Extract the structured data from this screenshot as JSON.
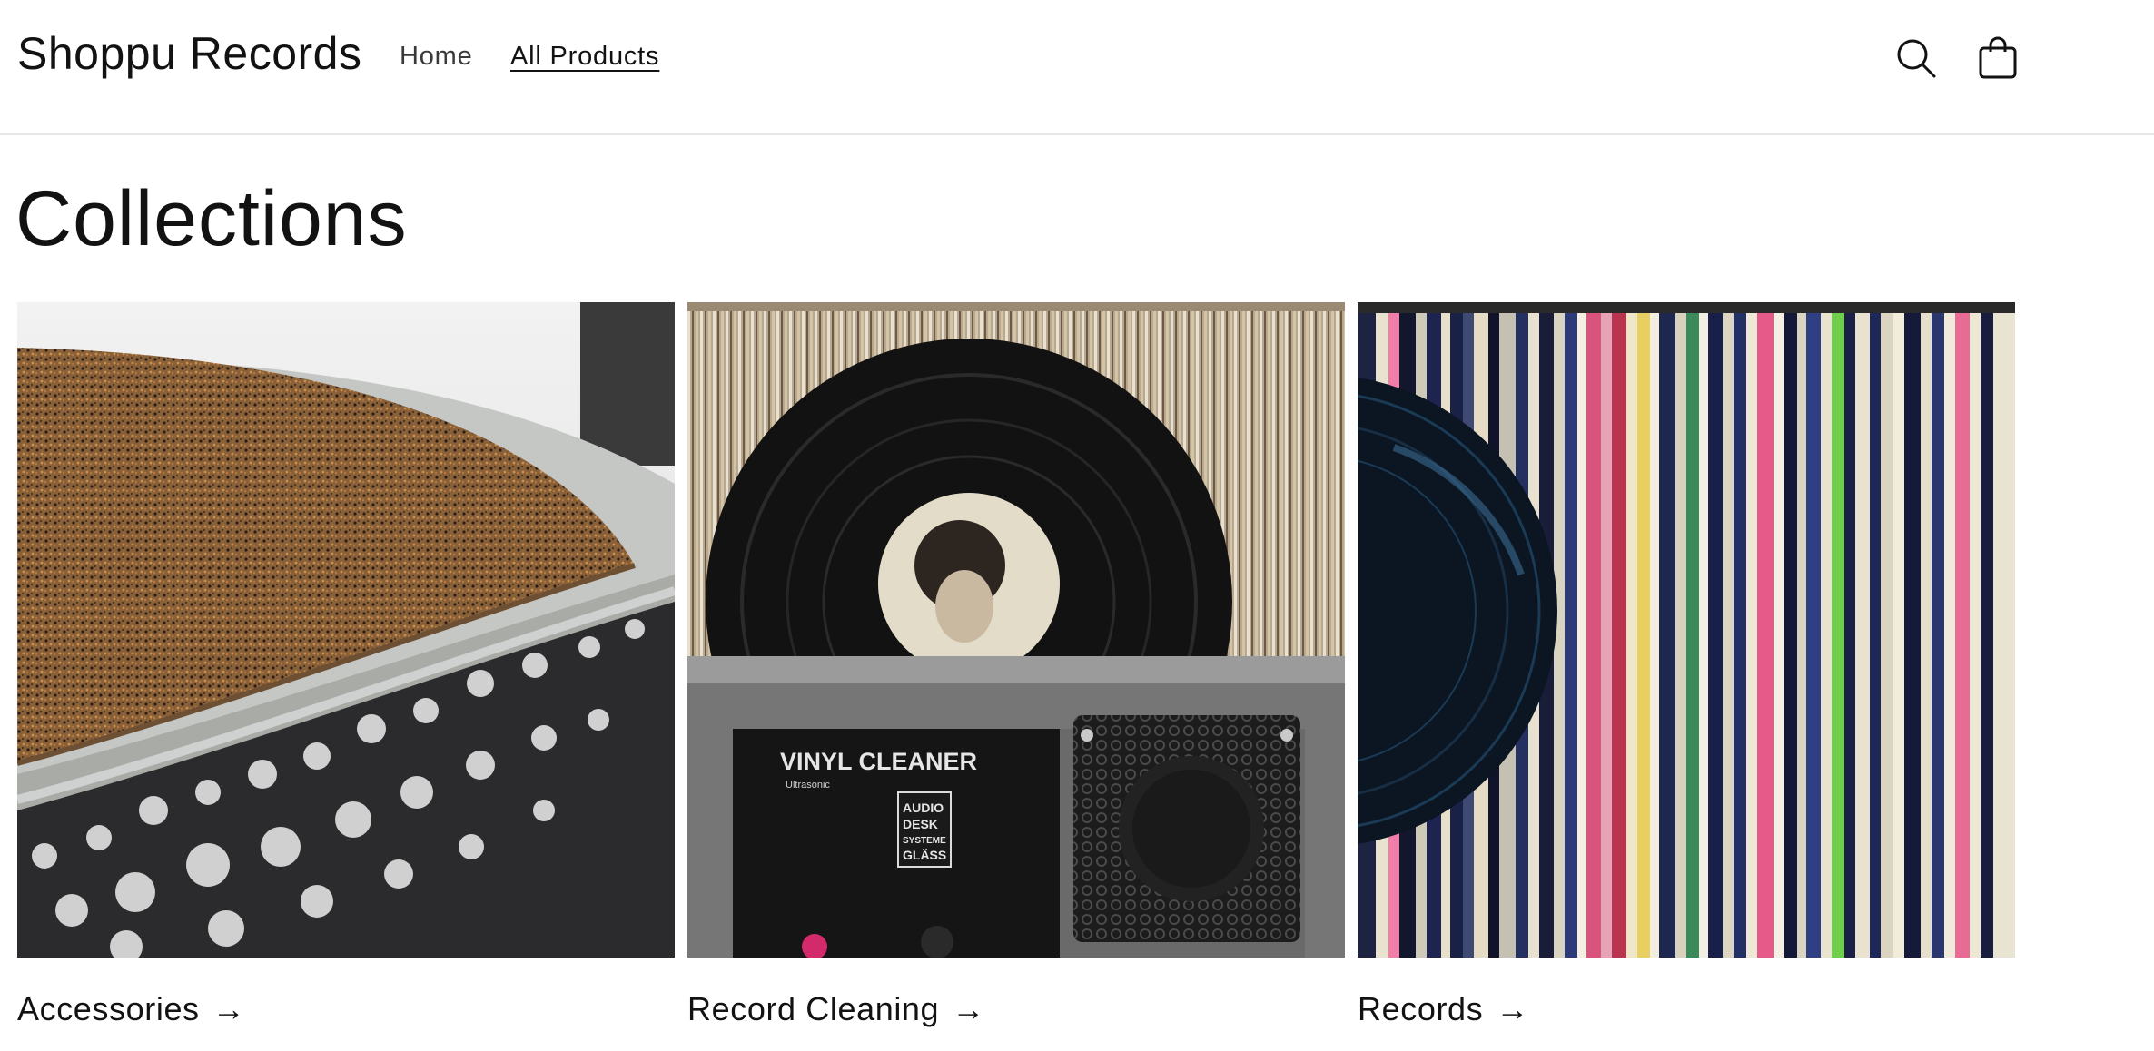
{
  "header": {
    "brand": "Shoppu Records",
    "nav": [
      {
        "label": "Home"
      },
      {
        "label": "All Products"
      }
    ],
    "icons": [
      "search-icon",
      "cart-icon"
    ]
  },
  "page": {
    "title": "Collections"
  },
  "collections": [
    {
      "title": "Accessories",
      "arrow": "→",
      "image": "turntable-cork-mat-photo"
    },
    {
      "title": "Record Cleaning",
      "arrow": "→",
      "image": "vinyl-cleaner-machine-photo"
    },
    {
      "title": "Records",
      "arrow": "→",
      "image": "vinyl-record-shelf-photo"
    }
  ],
  "photo_text": {
    "cleaner_label": "VINYL CLEANER",
    "cleaner_sub": "Ultrasonic",
    "cleaner_brand": "AUDIO DESK SYSTEME GLÄSS"
  }
}
